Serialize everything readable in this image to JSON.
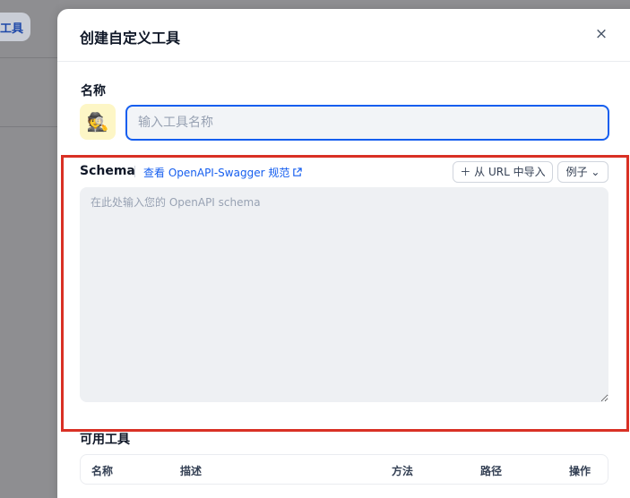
{
  "background": {
    "tab_label": "工具"
  },
  "modal": {
    "title": "创建自定义工具",
    "close_glyph": "×",
    "name_label": "名称",
    "avatar_emoji": "🕵️",
    "name_input": {
      "value": "",
      "placeholder": "输入工具名称"
    },
    "schema": {
      "label": "Schema",
      "spec_link": "查看 OpenAPI-Swagger 规范",
      "import_button": "＋ 从 URL 中导入",
      "example_button": "例子 ⌄",
      "textarea_placeholder": "在此处输入您的 OpenAPI schema"
    },
    "tools": {
      "label": "可用工具",
      "columns": [
        "名称",
        "描述",
        "方法",
        "路径",
        "操作"
      ]
    }
  },
  "colors": {
    "accent": "#155eef",
    "annotation": "#d93025",
    "avatar_bg": "#fdf6c6"
  }
}
